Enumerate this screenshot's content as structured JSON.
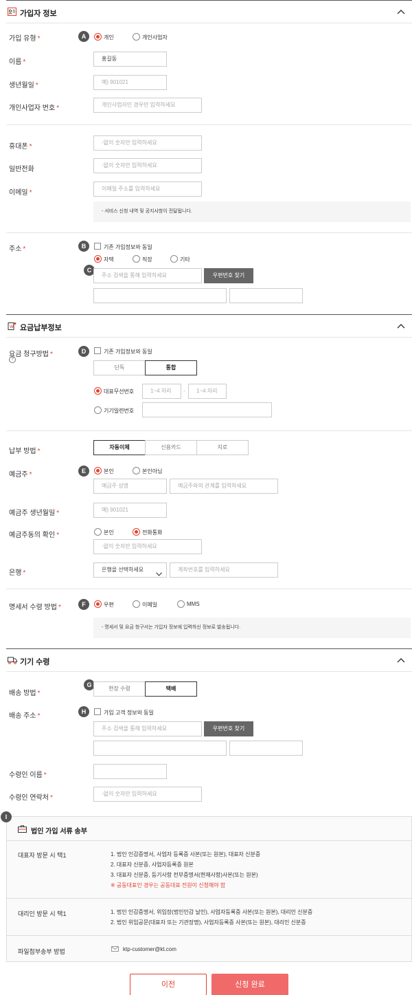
{
  "subscriber": {
    "title": "가입자 정보",
    "type_label": "가입 유형",
    "type_options": [
      "개인",
      "개인사업자"
    ],
    "name_label": "이름",
    "name_value": "홍길동",
    "birth_label": "생년월일",
    "birth_placeholder": "예) 901021",
    "bizno_label": "개인사업자 번호",
    "bizno_placeholder": "개인사업자인 경우만 입력하세요",
    "mobile_label": "휴대폰",
    "mobile_placeholder": "-없이 숫자만 입력하세요",
    "phone_label": "일반전화",
    "phone_placeholder": "-없이 숫자만 입력하세요",
    "email_label": "이메일",
    "email_placeholder": "이메일 주소를 입력하세요",
    "email_note": "- 서비스 신청 내역 및 공지사항이 전달됩니다.",
    "address_label": "주소",
    "address_same": "기존 가입정보와 동일",
    "address_types": [
      "자택",
      "직장",
      "기타"
    ],
    "address_placeholder": "주소 검색을 통해 입력하세요",
    "zip_button": "우편번호 찾기"
  },
  "billing": {
    "title": "요금납부정보",
    "method_label": "요금 청구방법",
    "help_glyph": "?",
    "same_label": "기존 가입정보와 동일",
    "segments": [
      "단독",
      "통합"
    ],
    "rep_label": "대표무선번호",
    "rep_ph1": "1~4 자리",
    "rep_ph2": "1~4 자리",
    "rep_dash": "-",
    "serial_label": "기기일련번호",
    "pay_label": "납부 방법",
    "pay_options": [
      "자동이체",
      "신용카드",
      "지로"
    ],
    "holder_label": "예금주",
    "holder_options": [
      "본인",
      "본인아님"
    ],
    "holder_name_ph": "예금주 성명",
    "holder_rel_ph": "예금주와의 관계를 입력하세요",
    "holder_birth_label": "예금주 생년월일",
    "holder_birth_ph": "예) 901021",
    "consent_label": "예금주동의 확인",
    "consent_options": [
      "본인",
      "전화통화"
    ],
    "consent_ph": "-없이 숫자만 입력하세요",
    "bank_label": "은행",
    "bank_select": "은행을 선택하세요",
    "account_ph": "계좌번호를 입력하세요",
    "statement_label": "명세서 수령 방법",
    "statement_options": [
      "우편",
      "이메일",
      "MMS"
    ],
    "statement_note": "- 명세서 및 요금 청구서는 가입자 정보에 입력하신 정보로 발송됩니다."
  },
  "device": {
    "title": "기기 수령",
    "delivery_label": "배송 방법",
    "delivery_options": [
      "현장 수령",
      "택배"
    ],
    "ship_label": "배송 주소",
    "ship_same": "가입 고객 정보와 동일",
    "ship_placeholder": "주소 검색을 통해 입력하세요",
    "zip_button": "우편번호 찾기",
    "recipient_label": "수령인 이름",
    "recipient_phone_label": "수령인 연락처",
    "recipient_phone_ph": "-없이 숫자만 입력하세요"
  },
  "corp": {
    "title": "법인 가입 서류 송부",
    "rep_visit_label": "대표자 방문 시 택1",
    "rep_visit_lines": [
      "1. 법인 인감증명서, 사업자 등록증 사본(또는 원본), 대표자 신분증",
      "2. 대표자 신분증, 사업자등록증 원본",
      "3. 대표자 신분증, 등기사항 전부증명서(현재사항)사본(또는 원본)"
    ],
    "rep_visit_warn": "※ 공동대표인 경우는 공동대표 전원이 신청해야 함",
    "agent_visit_label": "대리인 방문 시 택1",
    "agent_visit_lines": [
      "1. 법인 인감증명서, 위임장(법인인감 날인), 사업자등록증 사본(또는 원본), 대리인 신분증",
      "2. 법인 위임공문(대표자 또는 기관장명), 사업자등록증 사본(또는 원본), 대리인 신분증"
    ],
    "file_label": "파일첨부송부 방법",
    "file_email": "ktp-customer@kt.com"
  },
  "markers": [
    "A",
    "B",
    "C",
    "D",
    "E",
    "F",
    "G",
    "H",
    "I"
  ],
  "required_mark": "*",
  "buttons": {
    "prev": "이전",
    "submit": "신청 완료"
  },
  "colors": {
    "accent": "#e2412e",
    "submit_bg": "#f06a6a"
  }
}
